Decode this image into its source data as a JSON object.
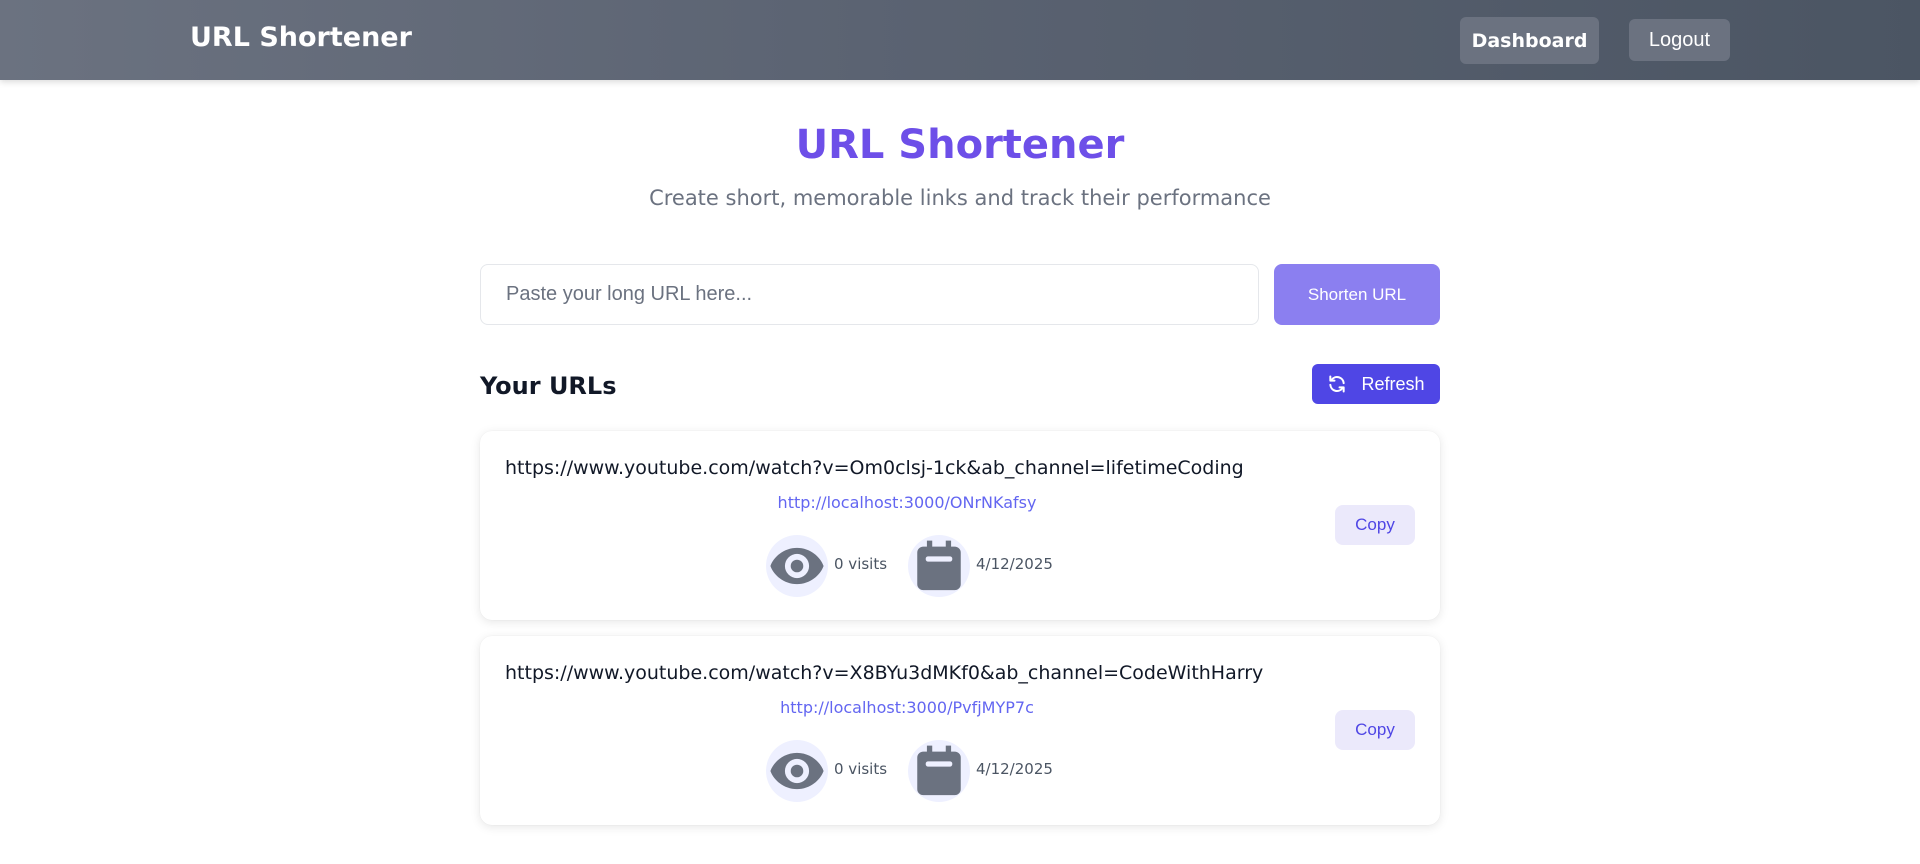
{
  "navbar": {
    "brand": "URL Shortener",
    "dashboard_label": "Dashboard",
    "logout_label": "Logout"
  },
  "hero": {
    "title": "URL Shortener",
    "subtitle": "Create short, memorable links and track their performance"
  },
  "form": {
    "input_value": "",
    "input_placeholder": "Paste your long URL here...",
    "shorten_label": "Shorten URL"
  },
  "urls_section": {
    "title": "Your URLs",
    "refresh_label": "Refresh",
    "items": [
      {
        "long_url": "https://www.youtube.com/watch?v=Om0clsj-1ck&ab_channel=lifetimeCoding",
        "short_url": "http://localhost:3000/ONrNKafsy",
        "visits": "0 visits",
        "date": "4/12/2025",
        "copy_label": "Copy"
      },
      {
        "long_url": "https://www.youtube.com/watch?v=X8BYu3dMKf0&ab_channel=CodeWithHarry",
        "short_url": "http://localhost:3000/PvfjMYP7c",
        "visits": "0 visits",
        "date": "4/12/2025",
        "copy_label": "Copy"
      }
    ]
  },
  "icons": {
    "visits": "eye-icon",
    "date": "calendar-icon",
    "refresh": "refresh-icon"
  },
  "colors": {
    "accent": "#4f46e5",
    "title": "#6d4fe8",
    "link": "#6366f1",
    "navbar": "#5b6372"
  }
}
